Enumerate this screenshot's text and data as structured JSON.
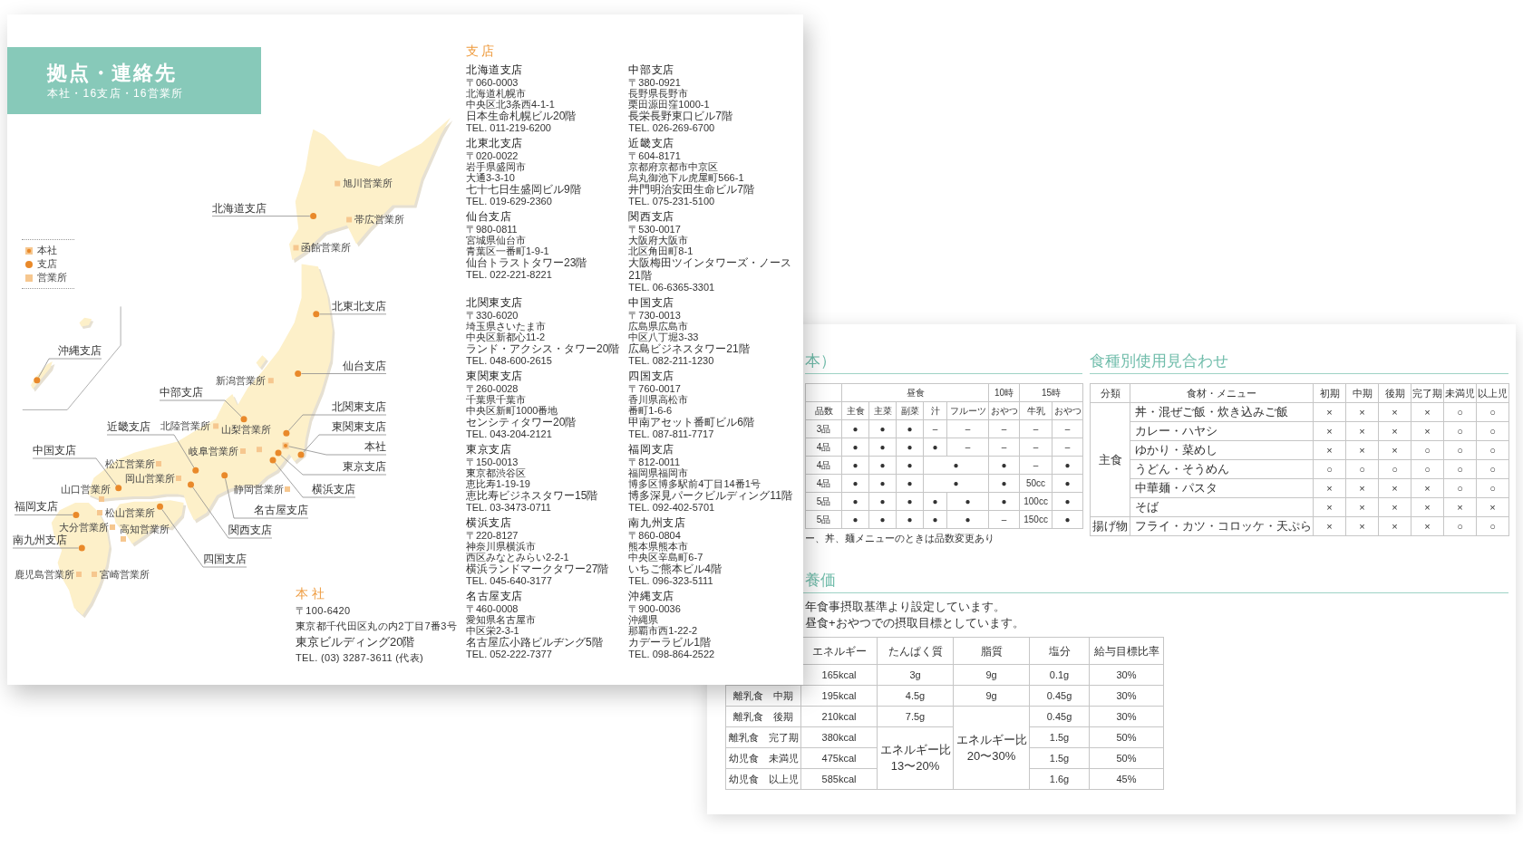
{
  "left_page": {
    "banner": {
      "title": "拠点・連絡先",
      "subtitle": "本社・16支店・16営業所"
    },
    "legend": [
      {
        "kind": "head_office",
        "label": "本社"
      },
      {
        "kind": "branch",
        "label": "支店"
      },
      {
        "kind": "office",
        "label": "営業所"
      }
    ],
    "map": {
      "markers": [
        {
          "kind": "office",
          "label": "旭川営業所"
        },
        {
          "kind": "branch",
          "label": "北海道支店"
        },
        {
          "kind": "office",
          "label": "帯広営業所"
        },
        {
          "kind": "office",
          "label": "函館営業所"
        },
        {
          "kind": "branch",
          "label": "北東北支店"
        },
        {
          "kind": "branch",
          "label": "沖縄支店"
        },
        {
          "kind": "branch",
          "label": "仙台支店"
        },
        {
          "kind": "office",
          "label": "新潟営業所"
        },
        {
          "kind": "branch",
          "label": "中部支店"
        },
        {
          "kind": "branch",
          "label": "北関東支店"
        },
        {
          "kind": "branch",
          "label": "近畿支店"
        },
        {
          "kind": "office",
          "label": "北陸営業所"
        },
        {
          "kind": "office",
          "label": "山梨営業所"
        },
        {
          "kind": "branch",
          "label": "東関東支店"
        },
        {
          "kind": "branch",
          "label": "中国支店"
        },
        {
          "kind": "office",
          "label": "岐阜営業所"
        },
        {
          "kind": "head_office",
          "label": "本社"
        },
        {
          "kind": "office",
          "label": "松江営業所"
        },
        {
          "kind": "branch",
          "label": "東京支店"
        },
        {
          "kind": "office",
          "label": "岡山営業所"
        },
        {
          "kind": "office",
          "label": "山口営業所"
        },
        {
          "kind": "office",
          "label": "静岡営業所"
        },
        {
          "kind": "branch",
          "label": "横浜支店"
        },
        {
          "kind": "branch",
          "label": "福岡支店"
        },
        {
          "kind": "office",
          "label": "松山営業所"
        },
        {
          "kind": "branch",
          "label": "名古屋支店"
        },
        {
          "kind": "office",
          "label": "大分営業所"
        },
        {
          "kind": "office",
          "label": "高知営業所"
        },
        {
          "kind": "branch",
          "label": "関西支店"
        },
        {
          "kind": "branch",
          "label": "南九州支店"
        },
        {
          "kind": "branch",
          "label": "四国支店"
        },
        {
          "kind": "office",
          "label": "鹿児島営業所"
        },
        {
          "kind": "office",
          "label": "宮崎営業所"
        }
      ]
    },
    "head_office": {
      "heading": "本社",
      "lines": [
        "〒100-6420",
        "東京都千代田区丸の内2丁目7番3号",
        "東京ビルディング20階",
        "TEL. (03) 3287-3611 (代表)"
      ]
    },
    "branches": {
      "heading": "支店",
      "items": [
        {
          "name": "北海道支店",
          "lines": [
            "〒060-0003",
            "北海道札幌市",
            "中央区北3条西4-1-1",
            "日本生命札幌ビル20階",
            "TEL. 011-219-6200"
          ]
        },
        {
          "name": "北東北支店",
          "lines": [
            "〒020-0022",
            "岩手県盛岡市",
            "大通3-3-10",
            "七十七日生盛岡ビル9階",
            "TEL. 019-629-2360"
          ]
        },
        {
          "name": "仙台支店",
          "lines": [
            "〒980-0811",
            "宮城県仙台市",
            "青葉区一番町1-9-1",
            "仙台トラストタワー23階",
            "TEL. 022-221-8221"
          ]
        },
        {
          "name": "北関東支店",
          "lines": [
            "〒330-6020",
            "埼玉県さいたま市",
            "中央区新都心11-2",
            "ランド・アクシス・タワー20階",
            "TEL. 048-600-2615"
          ]
        },
        {
          "name": "東関東支店",
          "lines": [
            "〒260-0028",
            "千葉県千葉市",
            "中央区新町1000番地",
            "センシティタワー20階",
            "TEL. 043-204-2121"
          ]
        },
        {
          "name": "東京支店",
          "lines": [
            "〒150-0013",
            "東京都渋谷区",
            "恵比寿1-19-19",
            "恵比寿ビジネスタワー15階",
            "TEL. 03-3473-0711"
          ]
        },
        {
          "name": "横浜支店",
          "lines": [
            "〒220-8127",
            "神奈川県横浜市",
            "西区みなとみらい2-2-1",
            "横浜ランドマークタワー27階",
            "TEL. 045-640-3177"
          ]
        },
        {
          "name": "名古屋支店",
          "lines": [
            "〒460-0008",
            "愛知県名古屋市",
            "中区栄2-3-1",
            "名古屋広小路ビルヂング5階",
            "TEL. 052-222-7377"
          ]
        },
        {
          "name": "中部支店",
          "lines": [
            "〒380-0921",
            "長野県長野市",
            "栗田源田窪1000-1",
            "長栄長野東口ビル7階",
            "TEL. 026-269-6700"
          ]
        },
        {
          "name": "近畿支店",
          "lines": [
            "〒604-8171",
            "京都府京都市中京区",
            "烏丸御池下ル虎屋町566-1",
            "井門明治安田生命ビル7階",
            "TEL. 075-231-5100"
          ]
        },
        {
          "name": "関西支店",
          "lines": [
            "〒530-0017",
            "大阪府大阪市",
            "北区角田町8-1",
            "大阪梅田ツインタワーズ・ノース21階",
            "TEL. 06-6365-3301"
          ]
        },
        {
          "name": "中国支店",
          "lines": [
            "〒730-0013",
            "広島県広島市",
            "中区八丁堀3-33",
            "広島ビジネスタワー21階",
            "TEL. 082-211-1230"
          ]
        },
        {
          "name": "四国支店",
          "lines": [
            "〒760-0017",
            "香川県高松市",
            "番町1-6-6",
            "甲南アセット番町ビル6階",
            "TEL. 087-811-7717"
          ]
        },
        {
          "name": "福岡支店",
          "lines": [
            "〒812-0011",
            "福岡県福岡市",
            "博多区博多駅前4丁目14番1号",
            "博多深見パークビルディング11階",
            "TEL. 092-402-5701"
          ]
        },
        {
          "name": "南九州支店",
          "lines": [
            "〒860-0804",
            "熊本県熊本市",
            "中央区辛島町6-7",
            "いちご熊本ビル4階",
            "TEL. 096-323-5111"
          ]
        },
        {
          "name": "沖縄支店",
          "lines": [
            "〒900-0036",
            "沖縄県",
            "那覇市西1-22-2",
            "カデーラビル1階",
            "TEL. 098-864-2522"
          ]
        }
      ]
    }
  },
  "right_page": {
    "meal_section": {
      "heading": "本）",
      "table": {
        "row_header": "品数",
        "groups": [
          {
            "label": "昼食",
            "columns": [
              "主食",
              "主菜",
              "副菜",
              "汁",
              "フルーツ"
            ]
          },
          {
            "label": "10時",
            "columns": [
              "おやつ"
            ]
          },
          {
            "label": "15時",
            "columns": [
              "牛乳",
              "おやつ"
            ]
          }
        ],
        "rows": [
          {
            "label": "3品",
            "cells": [
              {
                "text": "●"
              },
              {
                "text": "●"
              },
              {
                "text": "●"
              },
              {
                "text": "–"
              },
              {
                "text": "–"
              },
              {
                "text": "–"
              },
              {
                "text": "–"
              },
              {
                "text": "–"
              }
            ]
          },
          {
            "label": "4品",
            "cells": [
              {
                "text": "●"
              },
              {
                "text": "●"
              },
              {
                "text": "●"
              },
              {
                "text": "●"
              },
              {
                "text": "–"
              },
              {
                "text": "–"
              },
              {
                "text": "–"
              },
              {
                "text": "–"
              }
            ]
          },
          {
            "label": "4品",
            "cells": [
              {
                "text": "●"
              },
              {
                "text": "●"
              },
              {
                "text": "●"
              },
              {
                "text": "●",
                "colspan": 2
              },
              {
                "text": "●"
              },
              {
                "text": "–"
              },
              {
                "text": "●"
              }
            ]
          },
          {
            "label": "4品",
            "cells": [
              {
                "text": "●"
              },
              {
                "text": "●"
              },
              {
                "text": "●"
              },
              {
                "text": "●",
                "colspan": 2
              },
              {
                "text": "●"
              },
              {
                "text": "50cc"
              },
              {
                "text": "●"
              }
            ]
          },
          {
            "label": "5品",
            "cells": [
              {
                "text": "●"
              },
              {
                "text": "●"
              },
              {
                "text": "●"
              },
              {
                "text": "●"
              },
              {
                "text": "●"
              },
              {
                "text": "●"
              },
              {
                "text": "100cc"
              },
              {
                "text": "●"
              }
            ]
          },
          {
            "label": "5品",
            "cells": [
              {
                "text": "●"
              },
              {
                "text": "●"
              },
              {
                "text": "●"
              },
              {
                "text": "●"
              },
              {
                "text": "●"
              },
              {
                "text": "–"
              },
              {
                "text": "150cc"
              },
              {
                "text": "●"
              }
            ]
          }
        ]
      },
      "note": "ー、丼、麺メニューのときは品数変更あり"
    },
    "usage_section": {
      "heading": "食種別使用見合わせ",
      "table": {
        "columns": [
          "分類",
          "食材・メニュー",
          "初期",
          "中期",
          "後期",
          "完了期",
          "未満児",
          "以上児"
        ],
        "groups": [
          {
            "category": "主食",
            "rows": [
              {
                "item": "丼・混ぜご飯・炊き込みご飯",
                "marks": [
                  "×",
                  "×",
                  "×",
                  "×",
                  "○",
                  "○"
                ]
              },
              {
                "item": "カレー・ハヤシ",
                "marks": [
                  "×",
                  "×",
                  "×",
                  "×",
                  "○",
                  "○"
                ]
              },
              {
                "item": "ゆかり・菜めし",
                "marks": [
                  "×",
                  "×",
                  "×",
                  "○",
                  "○",
                  "○"
                ]
              },
              {
                "item": "うどん・そうめん",
                "marks": [
                  "○",
                  "○",
                  "○",
                  "○",
                  "○",
                  "○"
                ]
              },
              {
                "item": "中華麺・パスタ",
                "marks": [
                  "×",
                  "×",
                  "×",
                  "×",
                  "○",
                  "○"
                ]
              },
              {
                "item": "そば",
                "marks": [
                  "×",
                  "×",
                  "×",
                  "×",
                  "×",
                  "×"
                ]
              }
            ]
          },
          {
            "category": "揚げ物",
            "rows": [
              {
                "item": "フライ・カツ・コロッケ・天ぷら",
                "marks": [
                  "×",
                  "×",
                  "×",
                  "×",
                  "○",
                  "○"
                ]
              }
            ]
          }
        ]
      }
    },
    "nutrition_section": {
      "heading": "養価",
      "lines": [
        "年食事摂取基準より設定しています。",
        "昼食+おやつでの摂取目標としています。"
      ],
      "table": {
        "columns": [
          "エネルギー",
          "たんぱく質",
          "脂質",
          "塩分",
          "給与目標比率"
        ],
        "rows": [
          {
            "cells": [
              {
                "text": "165kcal"
              },
              {
                "text": "3g"
              },
              {
                "text": "9g"
              },
              {
                "text": "0.1g"
              },
              {
                "text": "30%"
              }
            ]
          },
          {
            "label": "離乳食　中期",
            "cells": [
              {
                "text": "195kcal"
              },
              {
                "text": "4.5g"
              },
              {
                "text": "9g"
              },
              {
                "text": "0.45g"
              },
              {
                "text": "30%"
              }
            ]
          },
          {
            "label": "離乳食　後期",
            "cells": [
              {
                "text": "210kcal"
              },
              {
                "text": "7.5g"
              },
              {
                "text": "エネルギー比 20〜30%",
                "rowspan": 4
              },
              {
                "text": "0.45g"
              },
              {
                "text": "30%"
              }
            ]
          },
          {
            "label": "離乳食　完了期",
            "cells": [
              {
                "text": "380kcal"
              },
              {
                "text": "エネルギー比 13〜20%",
                "rowspan": 3
              },
              {
                "text": "1.5g"
              },
              {
                "text": "50%"
              }
            ]
          },
          {
            "label": "幼児食　未満児",
            "cells": [
              {
                "text": "475kcal"
              },
              {
                "text": "1.5g"
              },
              {
                "text": "50%"
              }
            ]
          },
          {
            "label": "幼児食　以上児",
            "cells": [
              {
                "text": "585kcal"
              },
              {
                "text": "1.6g"
              },
              {
                "text": "45%"
              }
            ]
          }
        ]
      }
    }
  }
}
